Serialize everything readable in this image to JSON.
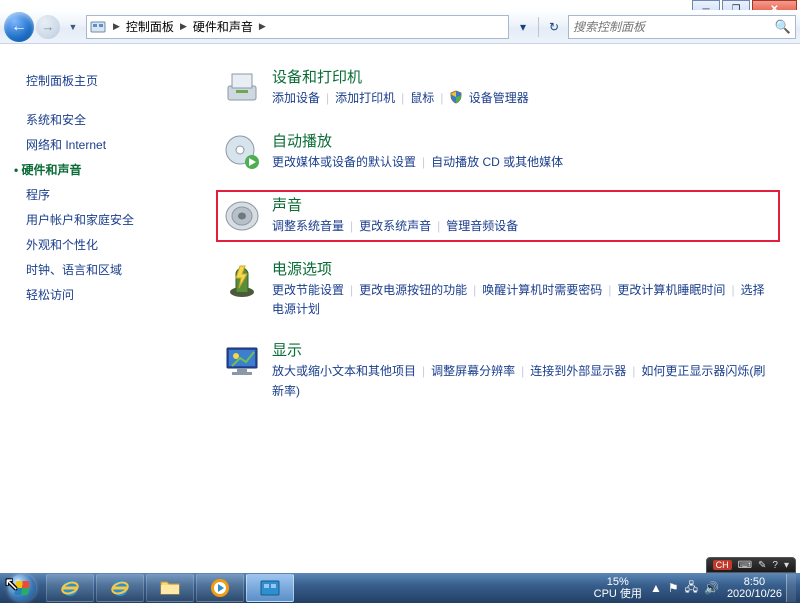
{
  "window": {
    "minimize": "─",
    "maximize": "❐",
    "close": "✕"
  },
  "nav": {
    "back_arrow": "←",
    "fwd_arrow": "→",
    "dropdown": "▼",
    "breadcrumb": [
      "控制面板",
      "硬件和声音"
    ],
    "refresh": "↻",
    "search_placeholder": "搜索控制面板"
  },
  "sidebar": {
    "items": [
      "控制面板主页",
      "系统和安全",
      "网络和 Internet",
      "硬件和声音",
      "程序",
      "用户帐户和家庭安全",
      "外观和个性化",
      "时钟、语言和区域",
      "轻松访问"
    ],
    "current_index": 3
  },
  "categories": [
    {
      "title": "设备和打印机",
      "highlighted": false,
      "links": [
        "添加设备",
        "添加打印机",
        "鼠标"
      ],
      "shielded": [
        "设备管理器"
      ]
    },
    {
      "title": "自动播放",
      "highlighted": false,
      "links": [
        "更改媒体或设备的默认设置",
        "自动播放 CD 或其他媒体"
      ],
      "shielded": []
    },
    {
      "title": "声音",
      "highlighted": true,
      "links": [
        "调整系统音量",
        "更改系统声音",
        "管理音频设备"
      ],
      "shielded": []
    },
    {
      "title": "电源选项",
      "highlighted": false,
      "links": [
        "更改节能设置",
        "更改电源按钮的功能",
        "唤醒计算机时需要密码",
        "更改计算机睡眠时间",
        "选择电源计划"
      ],
      "shielded": []
    },
    {
      "title": "显示",
      "highlighted": false,
      "links": [
        "放大或缩小文本和其他项目",
        "调整屏幕分辨率",
        "连接到外部显示器",
        "如何更正显示器闪烁(刷新率)"
      ],
      "shielded": []
    }
  ],
  "langbar": {
    "ime": "CH",
    "kbd": "⌨",
    "tool": "✎",
    "help": "?"
  },
  "taskbar": {
    "cpu_pct": "15%",
    "cpu_label": "CPU 使用",
    "time": "8:50",
    "date": "2020/10/26",
    "tray_up": "▲"
  }
}
